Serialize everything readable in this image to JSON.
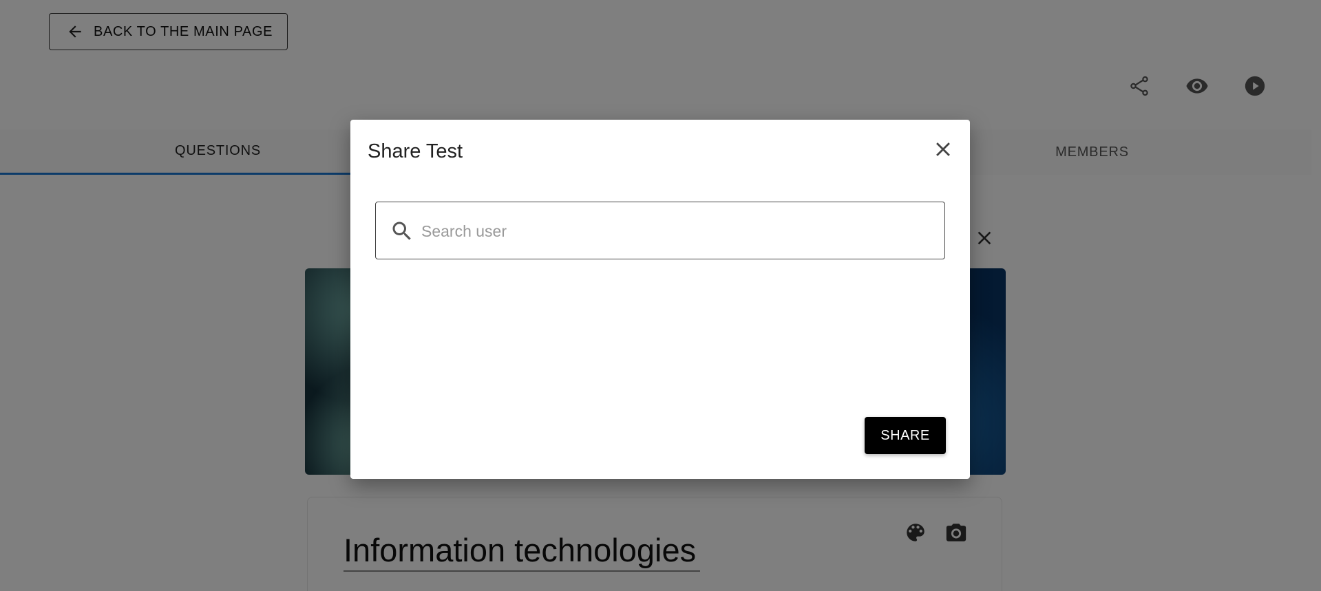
{
  "header": {
    "back_label": "BACK TO THE MAIN PAGE"
  },
  "top_actions": [
    "share-icon",
    "eye-icon",
    "play-icon"
  ],
  "tabs": [
    {
      "label": "QUESTIONS",
      "active": true
    },
    {
      "label": "MEMBERS",
      "active": false
    }
  ],
  "test_card": {
    "title": "Information technologies"
  },
  "dialog": {
    "title": "Share Test",
    "search_placeholder": "Search user",
    "search_value": "",
    "share_label": "SHARE"
  },
  "colors": {
    "accent": "#1976d2",
    "primary_button": "#000000",
    "overlay": "rgba(0,0,0,0.5)"
  }
}
